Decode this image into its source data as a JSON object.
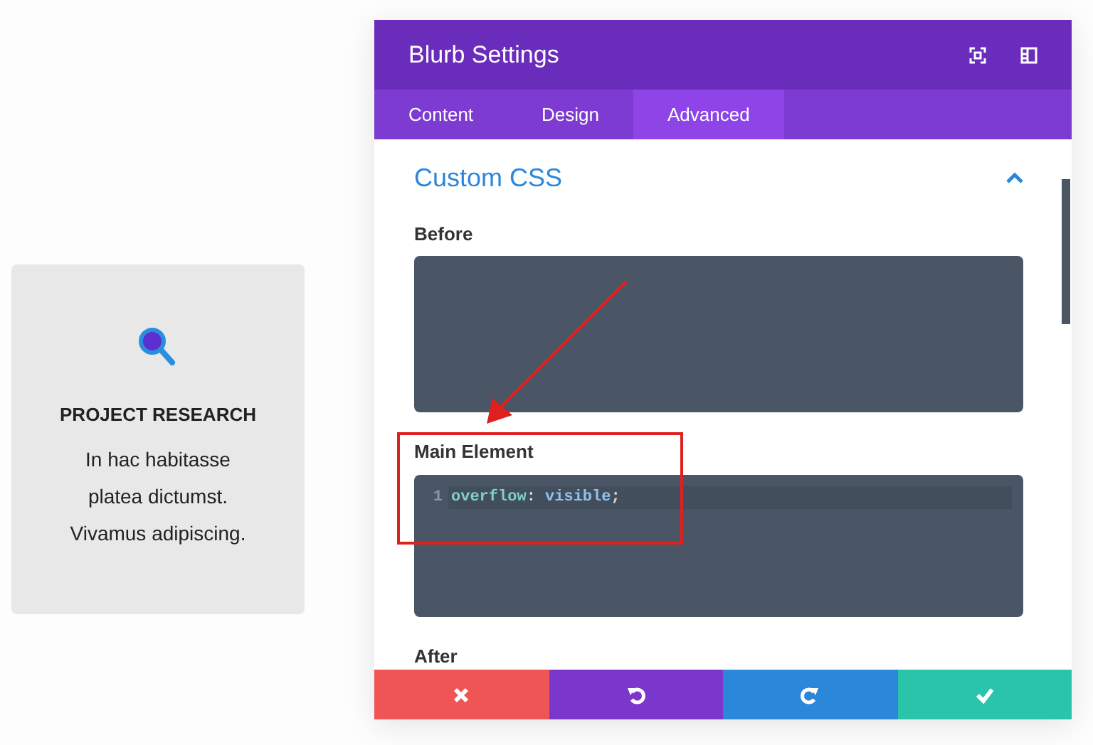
{
  "blurb_card": {
    "title": "PROJECT RESEARCH",
    "lines": [
      "In hac habitasse",
      "platea dictumst.",
      "Vivamus adipiscing."
    ]
  },
  "modal": {
    "title": "Blurb Settings",
    "tabs": [
      {
        "label": "Content",
        "selected": false
      },
      {
        "label": "Design",
        "selected": false
      },
      {
        "label": "Advanced",
        "selected": true
      }
    ],
    "section": {
      "title": "Custom CSS",
      "expanded": true
    },
    "fields": [
      {
        "label": "Before"
      },
      {
        "label": "Main Element",
        "lines": [
          {
            "number": "1",
            "property": "overflow",
            "colon": ":",
            "value": "visible",
            "semicolon": ";"
          }
        ]
      },
      {
        "label": "After"
      }
    ],
    "footer_buttons": [
      {
        "kind": "cancel"
      },
      {
        "kind": "undo"
      },
      {
        "kind": "redo"
      },
      {
        "kind": "save"
      }
    ]
  }
}
